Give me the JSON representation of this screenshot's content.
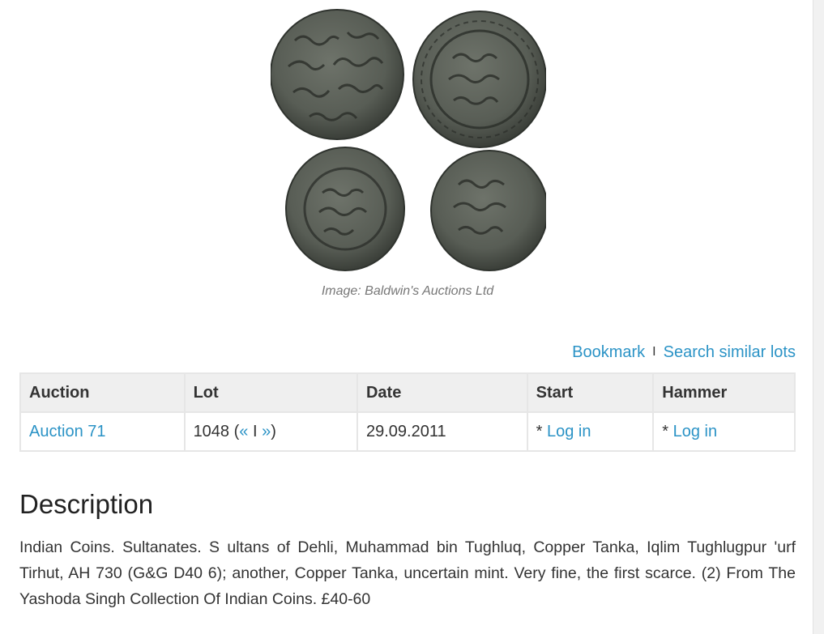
{
  "image": {
    "caption": "Image: Baldwin's Auctions Ltd",
    "coin_colors": {
      "face": "#5d625a",
      "rim": "#3e423c",
      "relief": "#2d302b"
    }
  },
  "actions": {
    "bookmark_label": "Bookmark",
    "separator": "I",
    "search_similar_label": "Search similar lots"
  },
  "table": {
    "headers": [
      "Auction",
      "Lot",
      "Date",
      "Start",
      "Hammer"
    ],
    "row": {
      "auction": "Auction 71",
      "lot_number": "1048 (",
      "lot_prev": "«",
      "lot_sep": " I ",
      "lot_next": "»",
      "lot_close": ")",
      "date": "29.09.2011",
      "start_prefix": "* ",
      "start_link": "Log in",
      "hammer_prefix": "* ",
      "hammer_link": "Log in"
    }
  },
  "description": {
    "title": "Description",
    "text": "Indian Coins. Sultanates. S ultans of Dehli, Muhammad bin Tughluq, Copper Tanka, Iqlim Tughlugpur 'urf Tirhut, AH 730 (G&G D40 6); another, Copper Tanka, uncertain mint. Very fine, the first scarce. (2) From The Yashoda Singh Collection Of Indian Coins. £40-60"
  },
  "colors": {
    "link": "#2b93c6",
    "header_bg": "#efefef",
    "border": "#e6e6e6"
  }
}
